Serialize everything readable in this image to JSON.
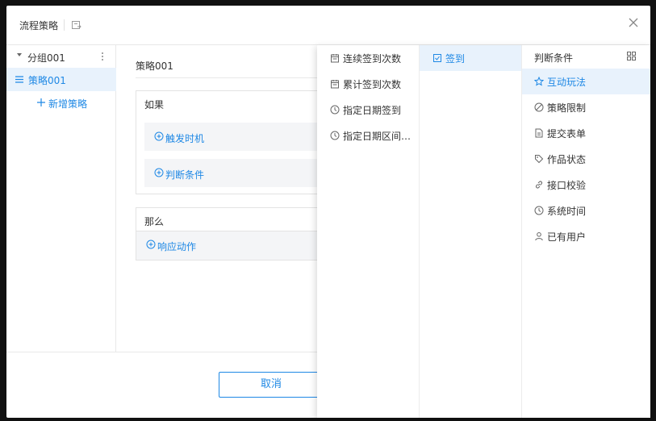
{
  "header": {
    "title": "流程策略"
  },
  "sidebar": {
    "group_label": "分组001",
    "policy_label": "策略001",
    "add_label": "新增策略"
  },
  "main": {
    "policy_name": "策略001",
    "if_card": {
      "title": "如果",
      "trigger_label": "触发时机",
      "condition_label": "判断条件"
    },
    "then_card": {
      "title": "那么",
      "action_label": "响应动作"
    }
  },
  "footer": {
    "cancel_label": "取消"
  },
  "panel": {
    "col1": [
      {
        "label": "连续签到次数",
        "icon": "calendar-icon"
      },
      {
        "label": "累计签到次数",
        "icon": "calendar-icon"
      },
      {
        "label": "指定日期签到",
        "icon": "clock-icon"
      },
      {
        "label": "指定日期区间…",
        "icon": "clock-icon"
      }
    ],
    "col2": [
      {
        "label": "签到",
        "icon": "checkin-icon",
        "active": true
      }
    ],
    "col3": {
      "title": "判断条件",
      "items": [
        {
          "label": "互动玩法",
          "icon": "star-icon",
          "active": true
        },
        {
          "label": "策略限制",
          "icon": "ban-icon"
        },
        {
          "label": "提交表单",
          "icon": "document-icon"
        },
        {
          "label": "作品状态",
          "icon": "tag-icon"
        },
        {
          "label": "接口校验",
          "icon": "link-icon"
        },
        {
          "label": "系统时间",
          "icon": "clock-icon"
        },
        {
          "label": "已有用户",
          "icon": "user-icon"
        }
      ]
    }
  },
  "colors": {
    "accent": "#1e88e5",
    "active_bg": "#e8f2fc",
    "slot_bg": "#f4f5f7"
  }
}
